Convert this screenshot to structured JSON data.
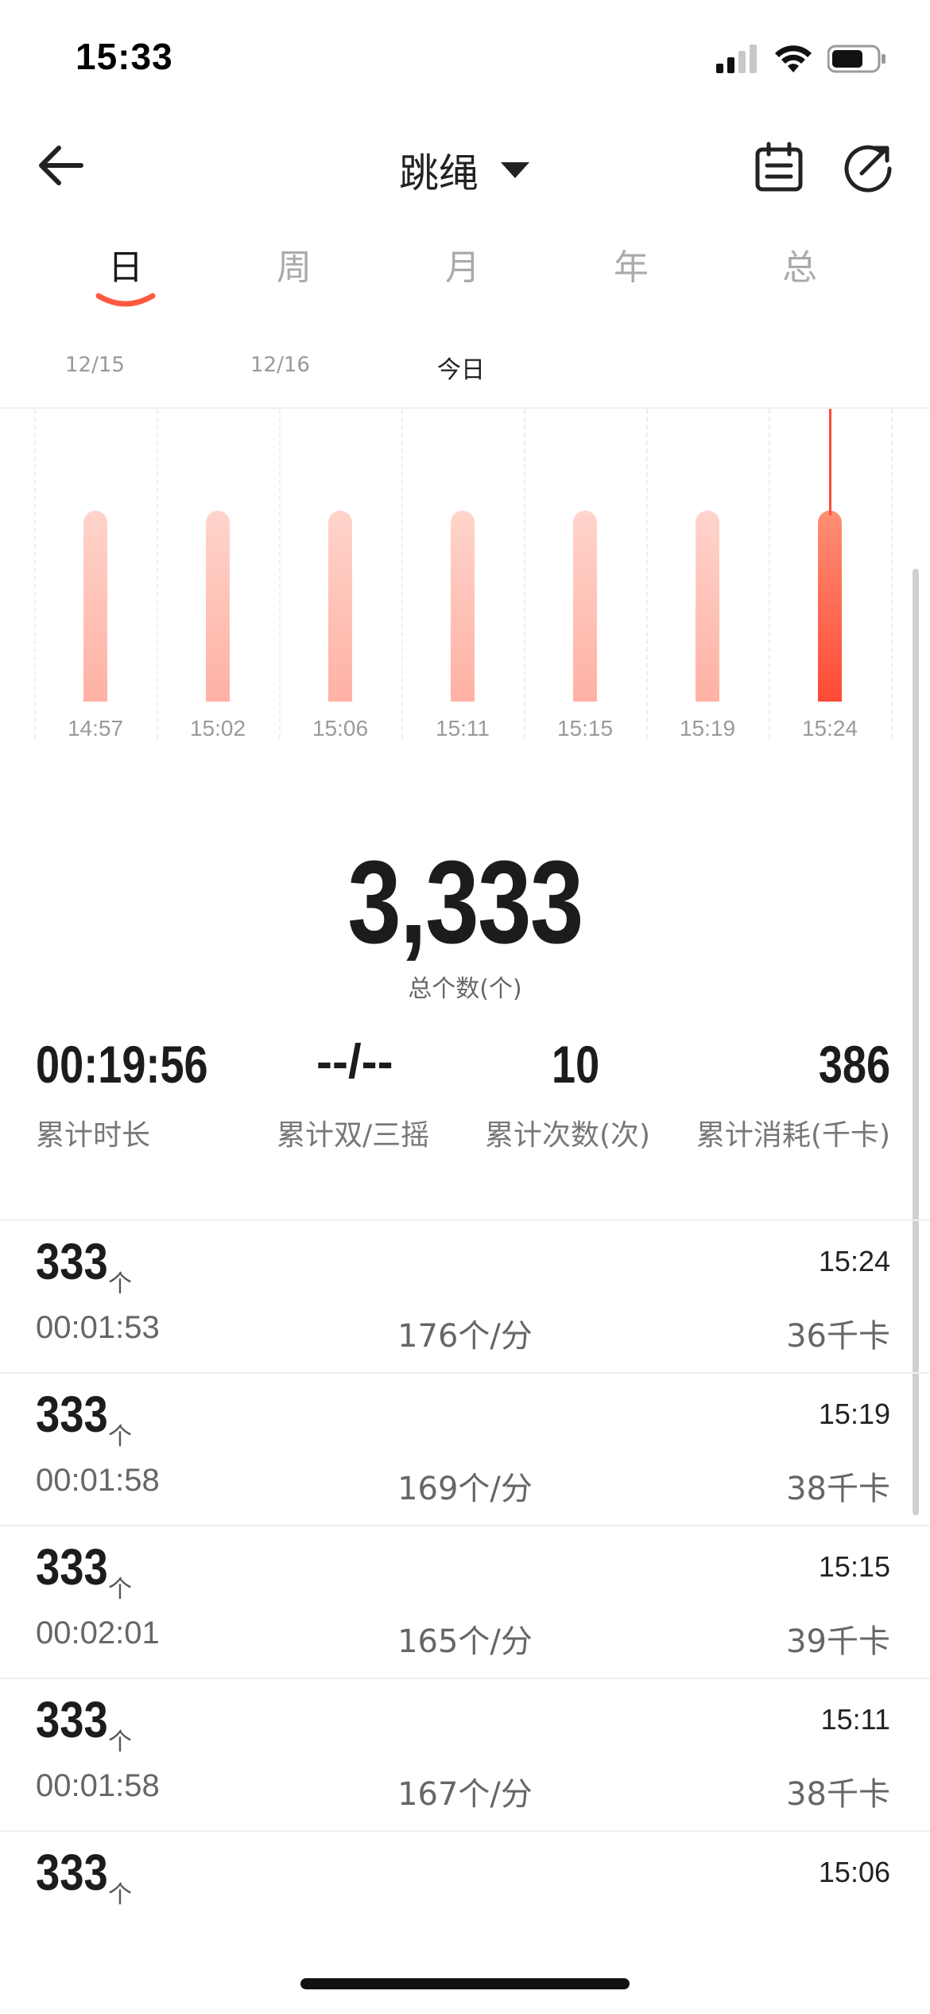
{
  "status_bar": {
    "time": "15:33"
  },
  "nav": {
    "title": "跳绳"
  },
  "tabs": [
    {
      "label": "日",
      "active": true
    },
    {
      "label": "周",
      "active": false
    },
    {
      "label": "月",
      "active": false
    },
    {
      "label": "年",
      "active": false
    },
    {
      "label": "总",
      "active": false
    }
  ],
  "day_labels": [
    "12/15",
    "12/16",
    "今日"
  ],
  "colors": {
    "accent": "#ff4a36",
    "bar_light": "#ffc0b4"
  },
  "chart_data": {
    "type": "bar",
    "categories": [
      "14:57",
      "15:02",
      "15:06",
      "15:11",
      "15:15",
      "15:19",
      "15:24"
    ],
    "values": [
      333,
      333,
      333,
      333,
      333,
      333,
      333
    ],
    "selected_index": 6,
    "ylim": [
      0,
      400
    ]
  },
  "summary": {
    "total_value": "3,333",
    "total_label": "总个数(个)",
    "stats": [
      {
        "value": "00:19:56",
        "label": "累计时长"
      },
      {
        "value": "--/--",
        "label": "累计双/三摇"
      },
      {
        "value": "10",
        "label": "累计次数(次)"
      },
      {
        "value": "386",
        "label": "累计消耗(千卡)"
      }
    ]
  },
  "sessions": [
    {
      "count": "333",
      "unit": "个",
      "time": "15:24",
      "duration": "00:01:53",
      "rate": "176个/分",
      "calories": "36千卡"
    },
    {
      "count": "333",
      "unit": "个",
      "time": "15:19",
      "duration": "00:01:58",
      "rate": "169个/分",
      "calories": "38千卡"
    },
    {
      "count": "333",
      "unit": "个",
      "time": "15:15",
      "duration": "00:02:01",
      "rate": "165个/分",
      "calories": "39千卡"
    },
    {
      "count": "333",
      "unit": "个",
      "time": "15:11",
      "duration": "00:01:58",
      "rate": "167个/分",
      "calories": "38千卡"
    },
    {
      "count": "333",
      "unit": "个",
      "time": "15:06",
      "duration": "",
      "rate": "",
      "calories": ""
    }
  ]
}
